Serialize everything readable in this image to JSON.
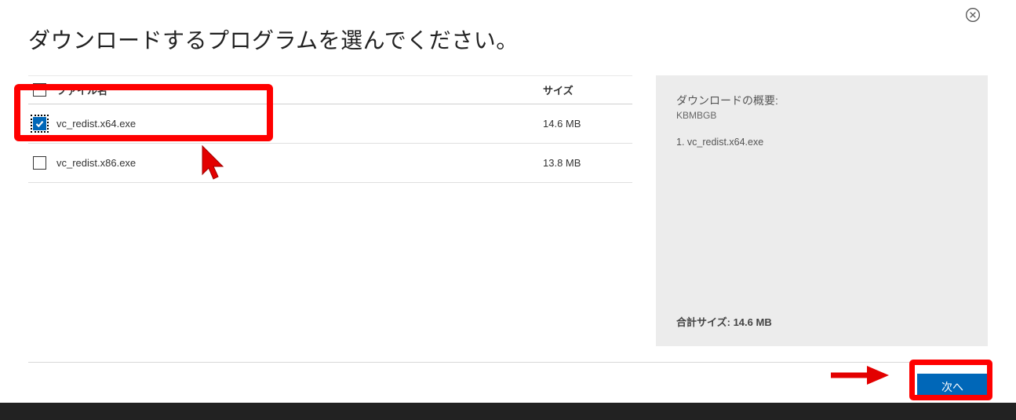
{
  "title": "ダウンロードするプログラムを選んでください。",
  "table": {
    "col_name": "ファイル名",
    "col_size": "サイズ",
    "rows": [
      {
        "name": "vc_redist.x64.exe",
        "size": "14.6 MB",
        "checked": true
      },
      {
        "name": "vc_redist.x86.exe",
        "size": "13.8 MB",
        "checked": false
      }
    ]
  },
  "summary": {
    "heading": "ダウンロードの概要:",
    "units": "KBMBGB",
    "items": [
      "1. vc_redist.x64.exe"
    ],
    "total_label": "合計サイズ:",
    "total_value": "14.6 MB"
  },
  "buttons": {
    "next": "次へ"
  }
}
